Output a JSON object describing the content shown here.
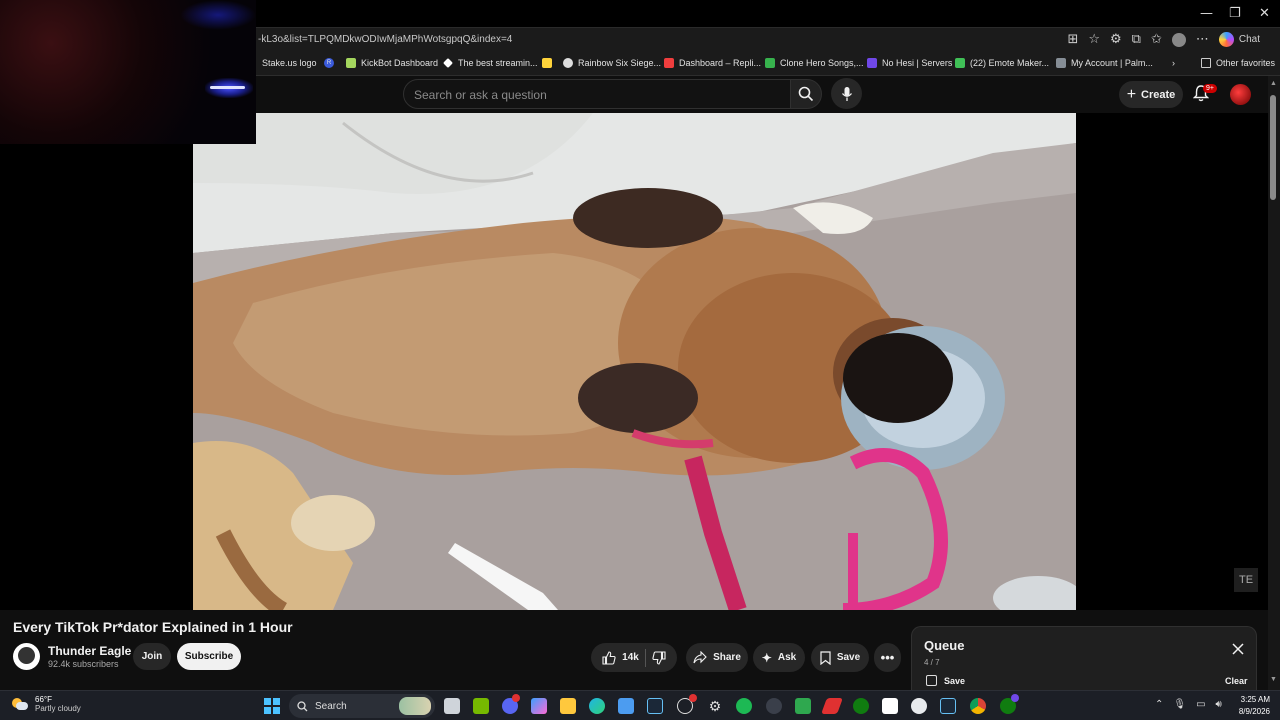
{
  "browser": {
    "url": "-kL3o&list=TLPQMDkwODIwMjaMPhWotsgpqQ&index=4",
    "window_controls": {
      "minimize": "—",
      "restore": "❐",
      "close": "✕"
    },
    "chat_label": "Chat",
    "bookmarks": [
      {
        "label": "Stake.us logo",
        "color": "#1b1b1b"
      },
      {
        "label": "",
        "color": "#3b5bdb"
      },
      {
        "label": "KickBot Dashboard",
        "color": "#a4d65e"
      },
      {
        "label": "The best streamin...",
        "color": "#ffffff"
      },
      {
        "label": "",
        "color": "#ffd43b"
      },
      {
        "label": "Rainbow Six Siege...",
        "color": "#dddddd"
      },
      {
        "label": "Dashboard – Repli...",
        "color": "#f03e3e"
      },
      {
        "label": "Clone Hero Songs,...",
        "color": "#37b24d"
      },
      {
        "label": "No Hesi | Servers",
        "color": "#7048e8"
      },
      {
        "label": "(22) Emote Maker...",
        "color": "#40c057"
      },
      {
        "label": "My Account | Palm...",
        "color": "#868e96"
      }
    ],
    "bookmark_letter": "R",
    "other_favorites": "Other favorites"
  },
  "youtube": {
    "search_placeholder": "Search or ask a question",
    "create_label": "Create",
    "notification_count": "9+"
  },
  "video": {
    "title": "Every TikTok Pr*dator Explained in 1 Hour",
    "corner_badge": "TE"
  },
  "channel": {
    "name": "Thunder Eagle",
    "subscribers": "92.4k subscribers",
    "join_label": "Join",
    "subscribe_label": "Subscribe"
  },
  "actions": {
    "likes": "14k",
    "share": "Share",
    "ask": "Ask",
    "save": "Save"
  },
  "queue": {
    "title": "Queue",
    "position": "4 / 7",
    "save": "Save",
    "clear": "Clear"
  },
  "taskbar": {
    "temperature": "66°F",
    "condition": "Partly cloudy",
    "search_label": "Search",
    "time": "3:25 AM",
    "date": "8/9/2026",
    "accent": "#4cc2ff"
  }
}
